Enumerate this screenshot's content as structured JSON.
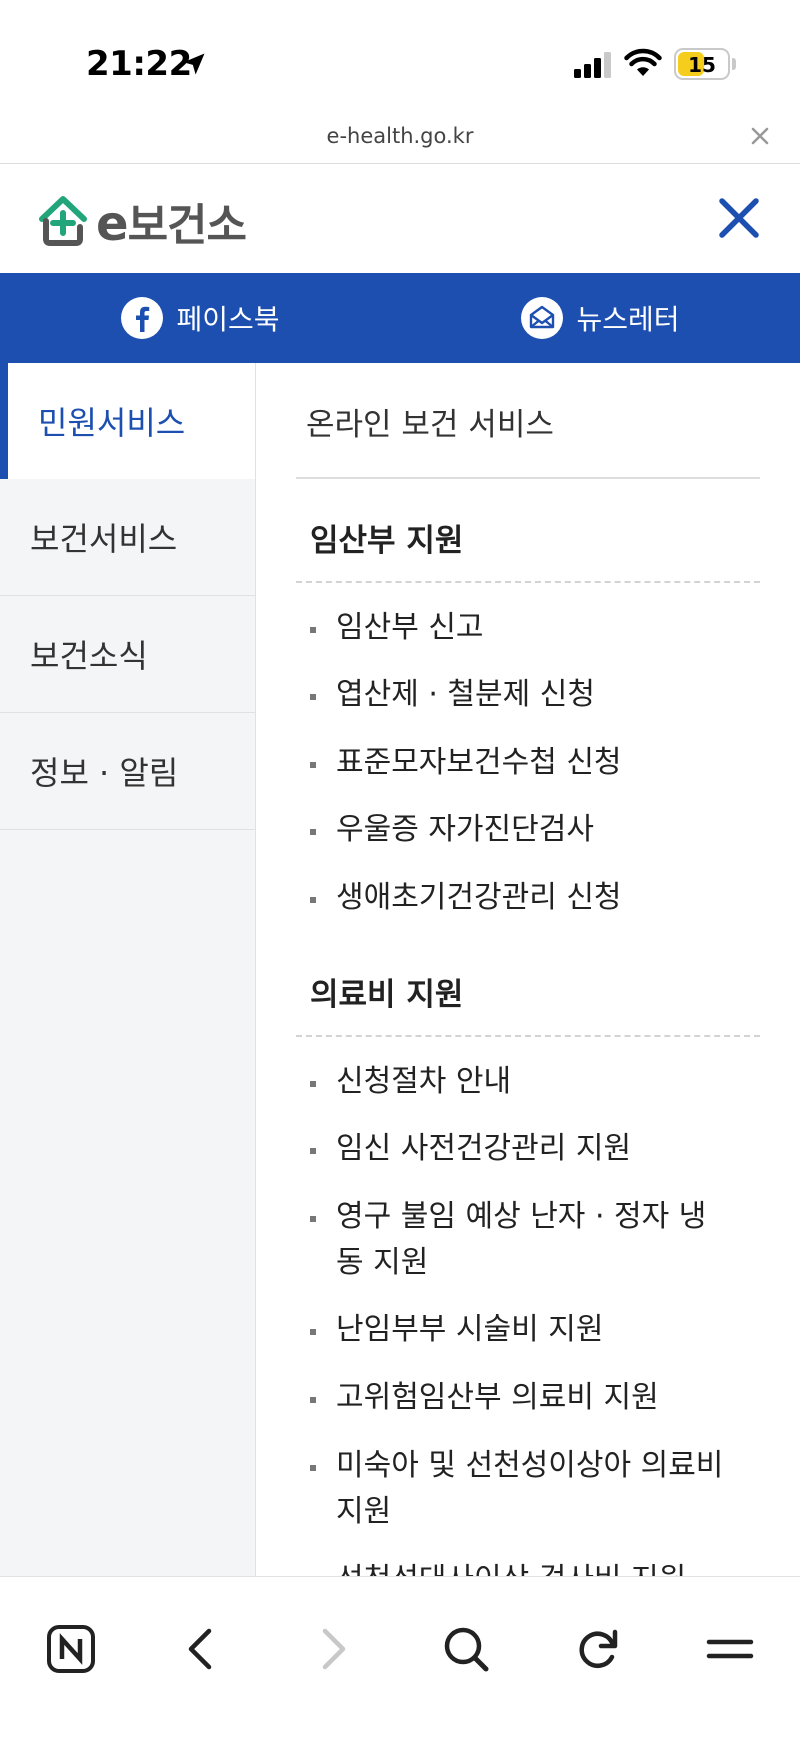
{
  "status": {
    "time": "21:22",
    "battery": "15",
    "battery_level": 0.15
  },
  "browser": {
    "url": "e-health.go.kr"
  },
  "site": {
    "logo_prefix": "e",
    "logo_name": "보건소"
  },
  "social": {
    "facebook": "페이스북",
    "newsletter": "뉴스레터"
  },
  "nav": {
    "items": [
      "민원서비스",
      "보건서비스",
      "보건소식",
      "정보 · 알림"
    ]
  },
  "panel": {
    "title": "온라인 보건 서비스",
    "sections": [
      {
        "title": "임산부 지원",
        "items": [
          "임산부 신고",
          "엽산제 · 철분제 신청",
          "표준모자보건수첩 신청",
          "우울증 자가진단검사",
          "생애초기건강관리 신청"
        ]
      },
      {
        "title": "의료비 지원",
        "items": [
          "신청절차 안내",
          "임신 사전건강관리 지원",
          "영구 불임 예상 난자 · 정자 냉동 지원",
          "난임부부 시술비 지원",
          "고위험임산부 의료비 지원",
          "미숙아 및 선천성이상아 의료비 지원",
          "선천성대사이상 검사비 지원"
        ]
      }
    ]
  },
  "colors": {
    "brand_blue": "#1d4fb1",
    "logo_green": "#22a57a",
    "nav_bg": "#f4f5f7"
  }
}
